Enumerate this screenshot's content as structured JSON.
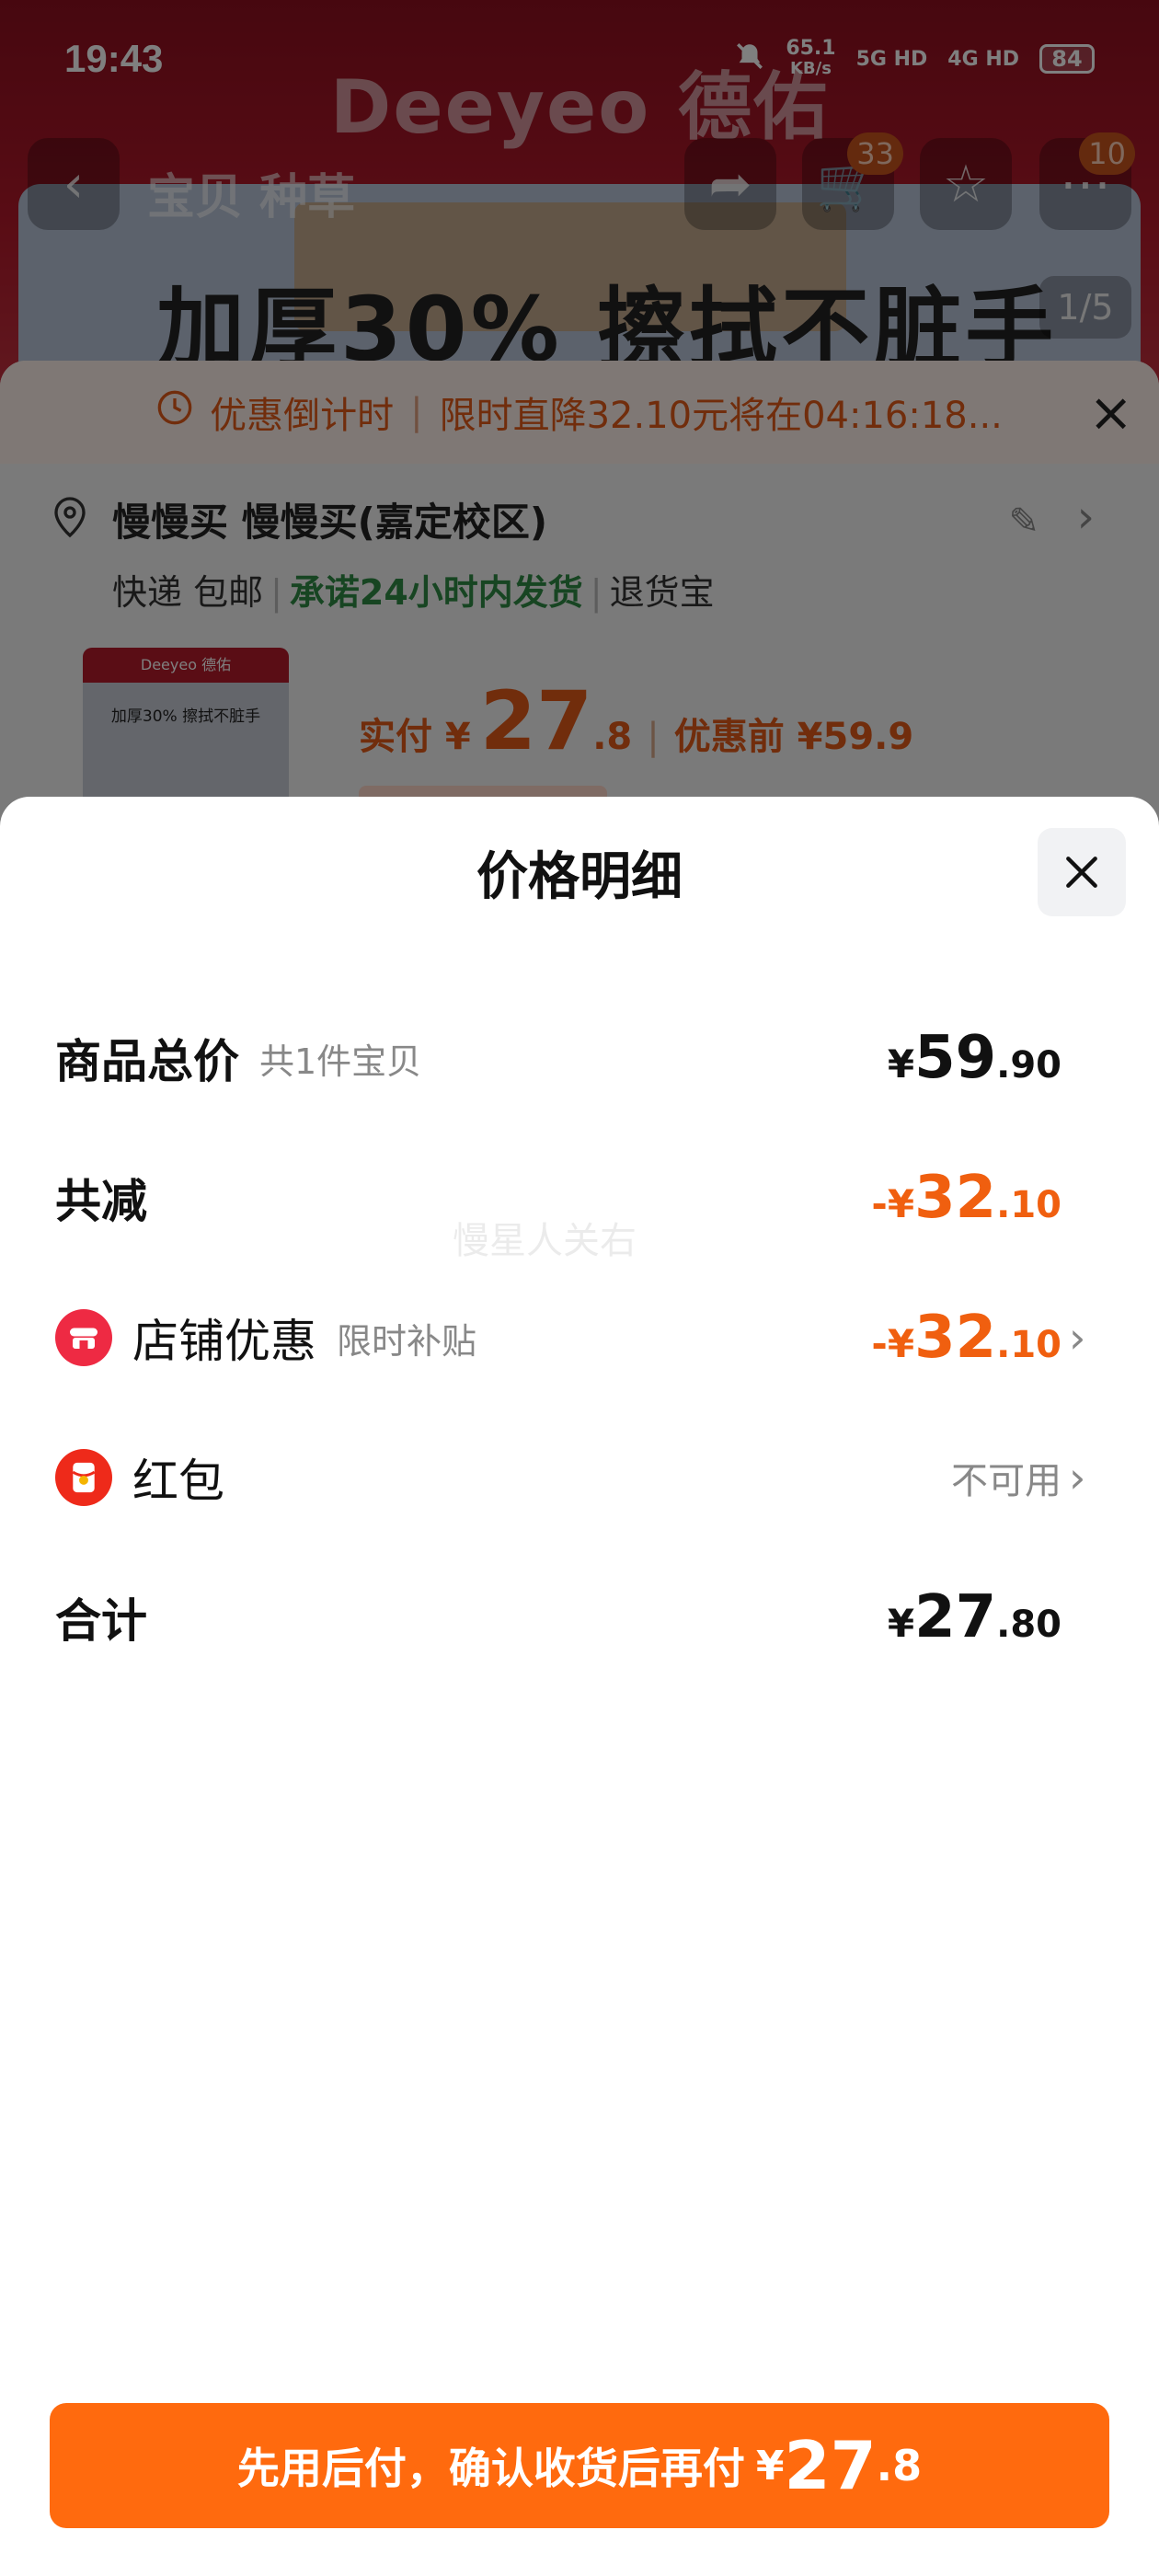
{
  "status_bar": {
    "time": "19:43",
    "net_speed": "65.1",
    "net_unit": "KB/s",
    "sim1": "5G HD",
    "sim2": "4G HD",
    "battery": "84"
  },
  "background": {
    "brand": "Deeyeo 德佑",
    "slogan": "加厚30% 擦拭不脏手",
    "image_pager": "1/5",
    "nav_tabs": "宝贝  种草",
    "cart_badge": "33",
    "more_badge": "10",
    "promo": {
      "label": "优惠倒计时",
      "text": "限时直降32.10元将在04:16:18..."
    },
    "address": {
      "name": "慢慢买 慢慢买(嘉定校区)",
      "tag_delivery": "快递 包邮",
      "tag_promise": "承诺24小时内发货",
      "tag_return": "退货宝"
    },
    "product": {
      "thumb_brand": "Deeyeo 德佑",
      "thumb_text": "加厚30% 擦拭不脏手",
      "paid_label": "实付 ¥",
      "paid_int": "27",
      "paid_dec": ".8",
      "before_label": "优惠前 ¥59.9"
    }
  },
  "sheet": {
    "title": "价格明细",
    "rows": {
      "total": {
        "label": "商品总价",
        "sub": "共1件宝贝",
        "cur": "¥",
        "int": "59",
        "dec": ".90"
      },
      "reduction": {
        "label": "共减",
        "cur": "-¥",
        "int": "32",
        "dec": ".10"
      },
      "shop": {
        "label": "店铺优惠",
        "sub": "限时补贴",
        "cur": "-¥",
        "int": "32",
        "dec": ".10"
      },
      "redpack": {
        "label": "红包",
        "value": "不可用"
      },
      "sum": {
        "label": "合计",
        "cur": "¥",
        "int": "27",
        "dec": ".80"
      }
    },
    "watermark": "慢星人关右",
    "pay_button": {
      "text": "先用后付，确认收货后再付",
      "cur": "¥",
      "int": "27",
      "dec": ".8"
    }
  },
  "colors": {
    "accent_orange": "#ff6a0e",
    "discount_orange": "#f05f0f",
    "brand_red": "#b41a2b",
    "promise_green": "#2e8b44"
  }
}
